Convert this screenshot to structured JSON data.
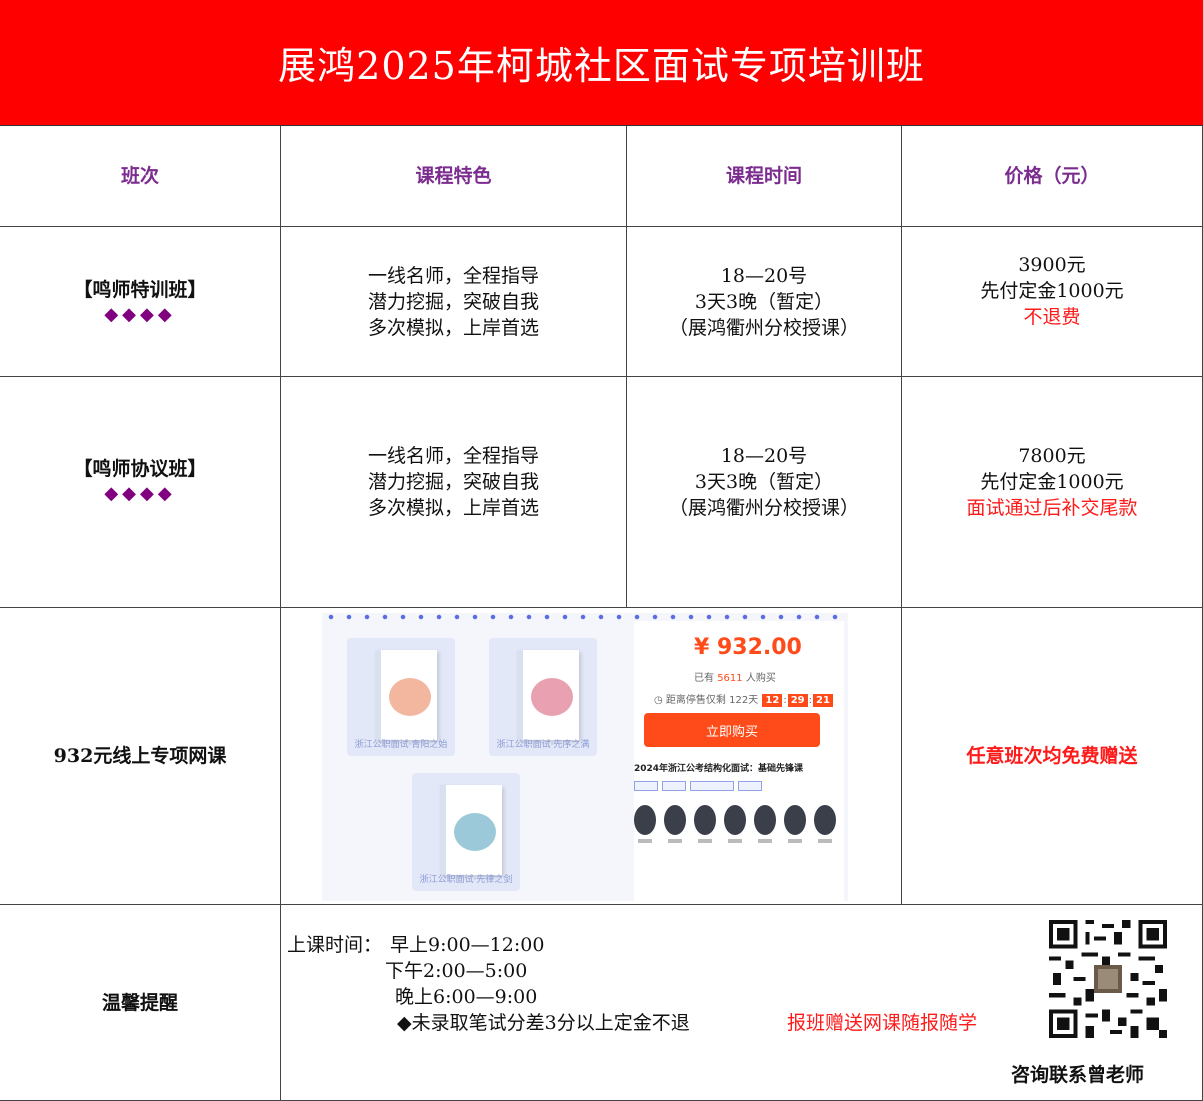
{
  "title": "展鸿2025年柯城社区面试专项培训班",
  "columns": [
    "班次",
    "课程特色",
    "课程时间",
    "价格（元）"
  ],
  "rows": [
    {
      "name": "【鸣师特训班】",
      "diamonds": "◆◆◆◆",
      "features": [
        "一线名师，全程指导",
        "潜力挖掘，突破自我",
        "多次模拟，上岸首选"
      ],
      "time": [
        "18—20号",
        "3天3晚（暂定）",
        "（展鸿衢州分校授课）"
      ],
      "price": [
        "3900元",
        "先付定金1000元"
      ],
      "price_note": "不退费"
    },
    {
      "name": "【鸣师协议班】",
      "diamonds": "◆◆◆◆",
      "features": [
        "一线名师，全程指导",
        "潜力挖掘，突破自我",
        "多次模拟，上岸首选"
      ],
      "time": [
        "18—20号",
        "3天3晚（暂定）",
        "（展鸿衢州分校授课）"
      ],
      "price": [
        "7800元",
        "先付定金1000元"
      ],
      "price_note": "面试通过后补交尾款"
    }
  ],
  "online": {
    "name": "932元线上专项网课",
    "note": "任意班次均免费赠送",
    "promo": {
      "price": "¥ 932.00",
      "sold_prefix": "已有",
      "sold_count": "5611",
      "sold_suffix": "人购买",
      "countdown_label": "距离停售仅剩",
      "countdown_days": "122天",
      "countdown_h": "12",
      "countdown_m": "29",
      "countdown_s": "21",
      "buy_label": "立即购买",
      "course_name": "2024年浙江公考结构化面试：基础先锋课",
      "books": [
        {
          "label": "浙江公职面试·青阳之始",
          "color": "#f3b7a0"
        },
        {
          "label": "浙江公职面试·先序之满",
          "color": "#e9a0b0"
        },
        {
          "label": "浙江公职面试·先律之剑",
          "color": "#9cc9d9"
        }
      ]
    }
  },
  "reminder": {
    "label": "温馨提醒",
    "schedule_label": "上课时间：",
    "morning": "早上9:00—12:00",
    "afternoon": "下午2:00—5:00",
    "evening": "晚上6:00—9:00",
    "rule": "◆未录取笔试分差3分以上定金不退",
    "gift": "报班赠送网课随报随学",
    "contact": "咨询联系曾老师"
  },
  "colors": {
    "header": "#ff0000",
    "heading_text": "#7b2c8f",
    "accent_red": "#ff1a1a",
    "diamond": "#800080"
  }
}
